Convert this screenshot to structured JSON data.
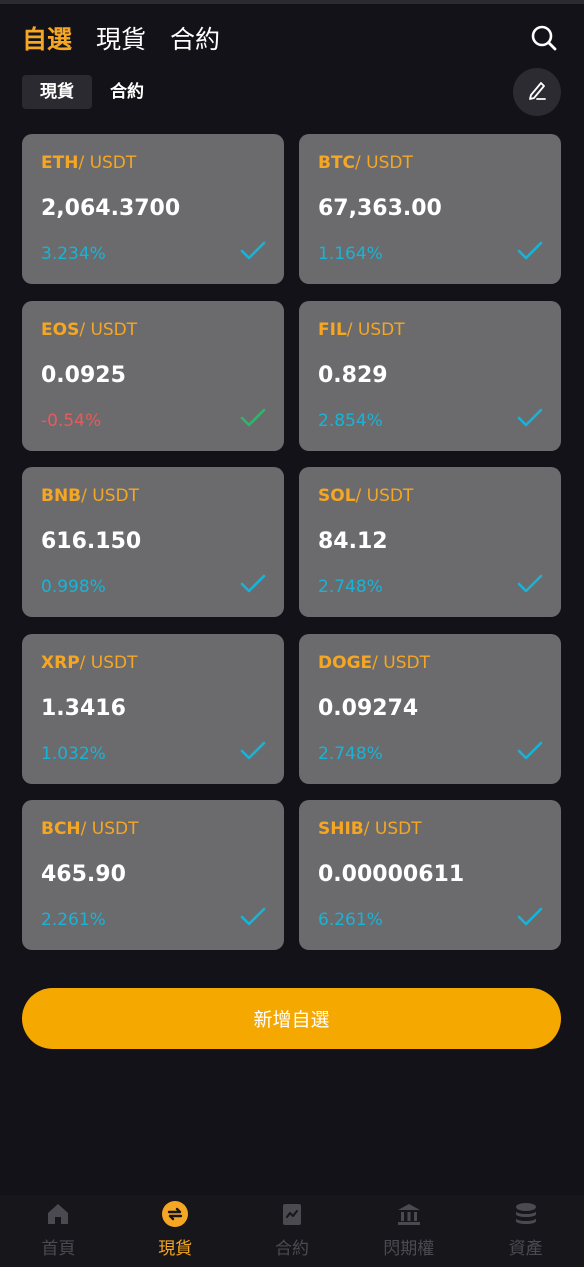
{
  "header": {
    "tabs": [
      "自選",
      "現貨",
      "合約"
    ],
    "active_tab": 0
  },
  "subtabs": {
    "items": [
      "現貨",
      "合約"
    ],
    "active": 0
  },
  "cards": [
    {
      "base": "ETH",
      "quote": "/ USDT",
      "price": "2,064.3700",
      "change": "3.234%",
      "negative": false
    },
    {
      "base": "BTC",
      "quote": "/ USDT",
      "price": "67,363.00",
      "change": "1.164%",
      "negative": false
    },
    {
      "base": "EOS",
      "quote": "/ USDT",
      "price": "0.0925",
      "change": "-0.54%",
      "negative": true
    },
    {
      "base": "FIL",
      "quote": "/ USDT",
      "price": "0.829",
      "change": "2.854%",
      "negative": false
    },
    {
      "base": "BNB",
      "quote": "/ USDT",
      "price": "616.150",
      "change": "0.998%",
      "negative": false
    },
    {
      "base": "SOL",
      "quote": "/ USDT",
      "price": "84.12",
      "change": "2.748%",
      "negative": false
    },
    {
      "base": "XRP",
      "quote": "/ USDT",
      "price": "1.3416",
      "change": "1.032%",
      "negative": false
    },
    {
      "base": "DOGE",
      "quote": "/ USDT",
      "price": "0.09274",
      "change": "2.748%",
      "negative": false
    },
    {
      "base": "BCH",
      "quote": "/ USDT",
      "price": "465.90",
      "change": "2.261%",
      "negative": false
    },
    {
      "base": "SHIB",
      "quote": "/ USDT",
      "price": "0.00000611",
      "change": "6.261%",
      "negative": false
    }
  ],
  "add_button": "新增自選",
  "nav": {
    "items": [
      {
        "label": "首頁",
        "icon": "home-icon"
      },
      {
        "label": "現貨",
        "icon": "exchange-icon"
      },
      {
        "label": "合約",
        "icon": "contract-icon"
      },
      {
        "label": "閃期權",
        "icon": "bank-icon"
      },
      {
        "label": "資產",
        "icon": "coins-icon"
      }
    ],
    "active": 1
  },
  "colors": {
    "accent": "#f5a623",
    "positive": "#19b3d6",
    "negative": "#e85a5a",
    "check_positive": "#19b3d6",
    "check_negative": "#2fb56a",
    "card_bg": "#6b6b6e",
    "page_bg": "#121218"
  }
}
